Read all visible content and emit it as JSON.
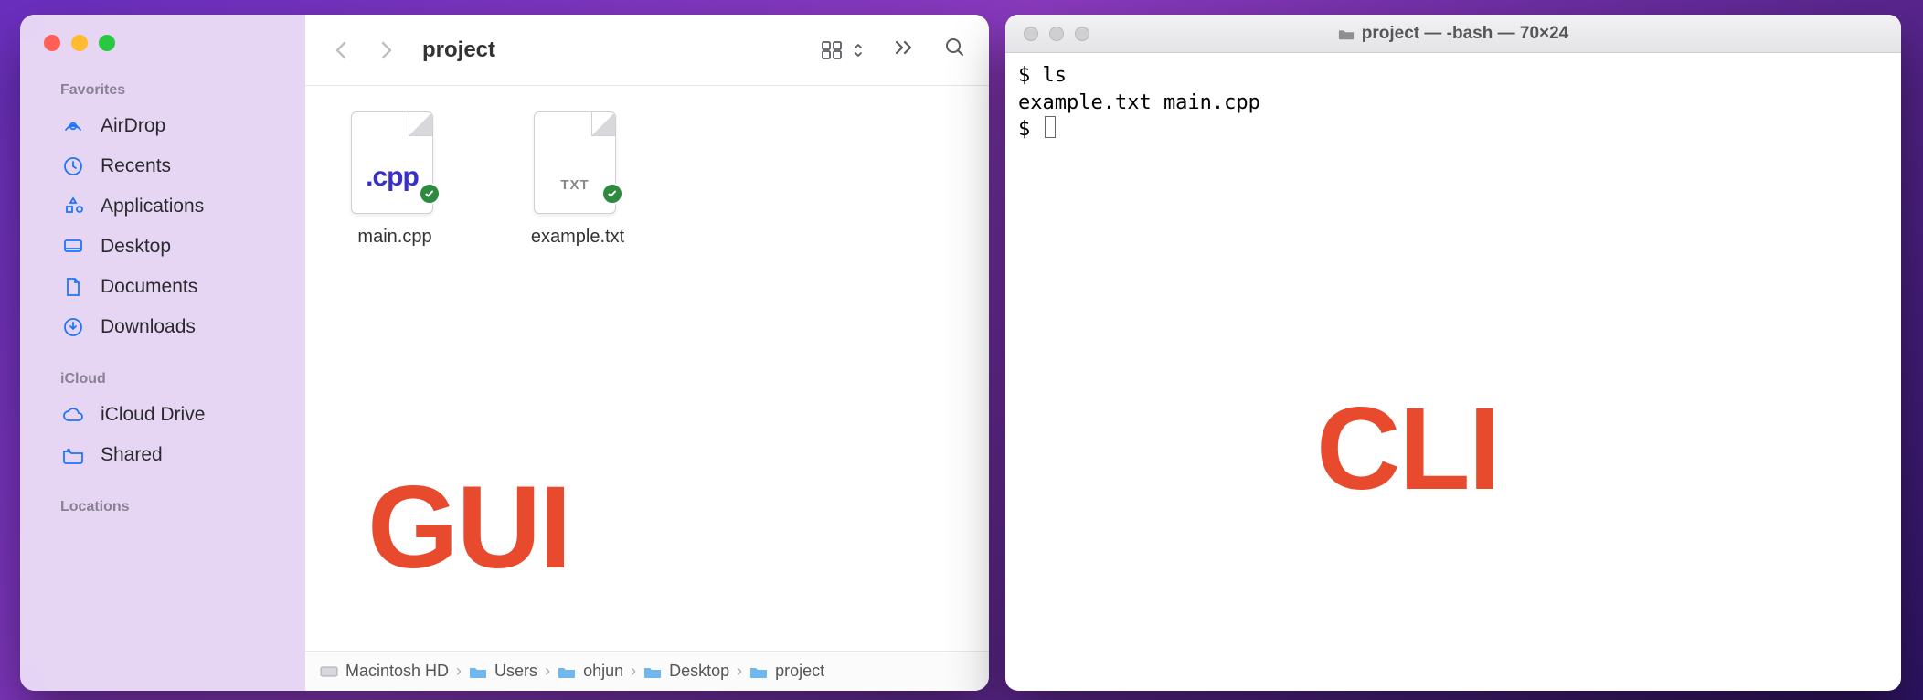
{
  "finder": {
    "title": "project",
    "sidebar": {
      "sections": [
        {
          "label": "Favorites",
          "items": [
            {
              "label": "AirDrop"
            },
            {
              "label": "Recents"
            },
            {
              "label": "Applications"
            },
            {
              "label": "Desktop"
            },
            {
              "label": "Documents"
            },
            {
              "label": "Downloads"
            }
          ]
        },
        {
          "label": "iCloud",
          "items": [
            {
              "label": "iCloud Drive"
            },
            {
              "label": "Shared"
            }
          ]
        },
        {
          "label": "Locations",
          "items": []
        }
      ]
    },
    "files": [
      {
        "name": "main.cpp",
        "ext_label": ".cpp",
        "ext_class": "ext-cpp",
        "synced": true
      },
      {
        "name": "example.txt",
        "ext_label": "TXT",
        "ext_class": "ext-txt",
        "synced": true
      }
    ],
    "overlay_label": "GUI",
    "path": [
      {
        "name": "Macintosh HD",
        "type": "hd"
      },
      {
        "name": "Users",
        "type": "folder"
      },
      {
        "name": "ohjun",
        "type": "folder"
      },
      {
        "name": "Desktop",
        "type": "folder"
      },
      {
        "name": "project",
        "type": "folder"
      }
    ]
  },
  "terminal": {
    "title": "project — -bash — 70×24",
    "lines": [
      "$ ls",
      "example.txt main.cpp",
      "$ "
    ],
    "overlay_label": "CLI"
  }
}
